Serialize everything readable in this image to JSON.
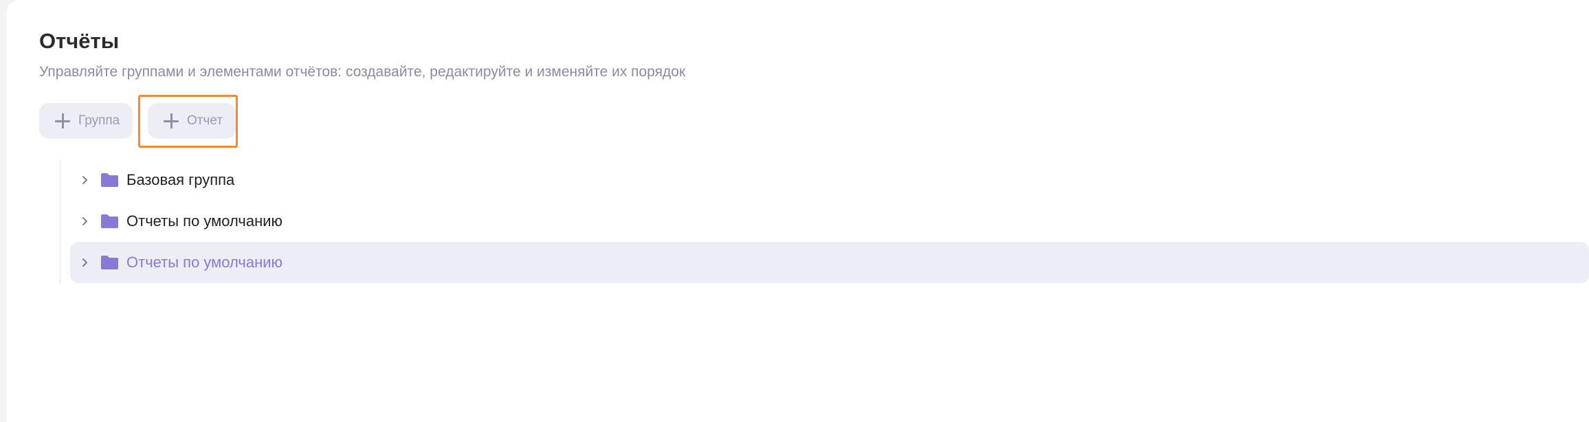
{
  "page": {
    "title": "Отчёты",
    "subtitle": "Управляйте группами и элементами отчётов: создавайте, редактируйте и изменяйте их порядок"
  },
  "toolbar": {
    "add_group_label": "Группа",
    "add_report_label": "Отчет"
  },
  "tree": {
    "items": [
      {
        "label": "Базовая группа",
        "icon": "folder-icon",
        "selected": false
      },
      {
        "label": "Отчеты по умолчанию",
        "icon": "folder-icon",
        "selected": false
      },
      {
        "label": "Отчеты по умолчанию",
        "icon": "folder-icon",
        "selected": true
      }
    ]
  },
  "colors": {
    "accent": "#8a78d8",
    "folder": "#8a78d8",
    "button_bg": "#ededf5",
    "highlight": "#f08a38",
    "selected_row_bg": "#ededf5"
  }
}
